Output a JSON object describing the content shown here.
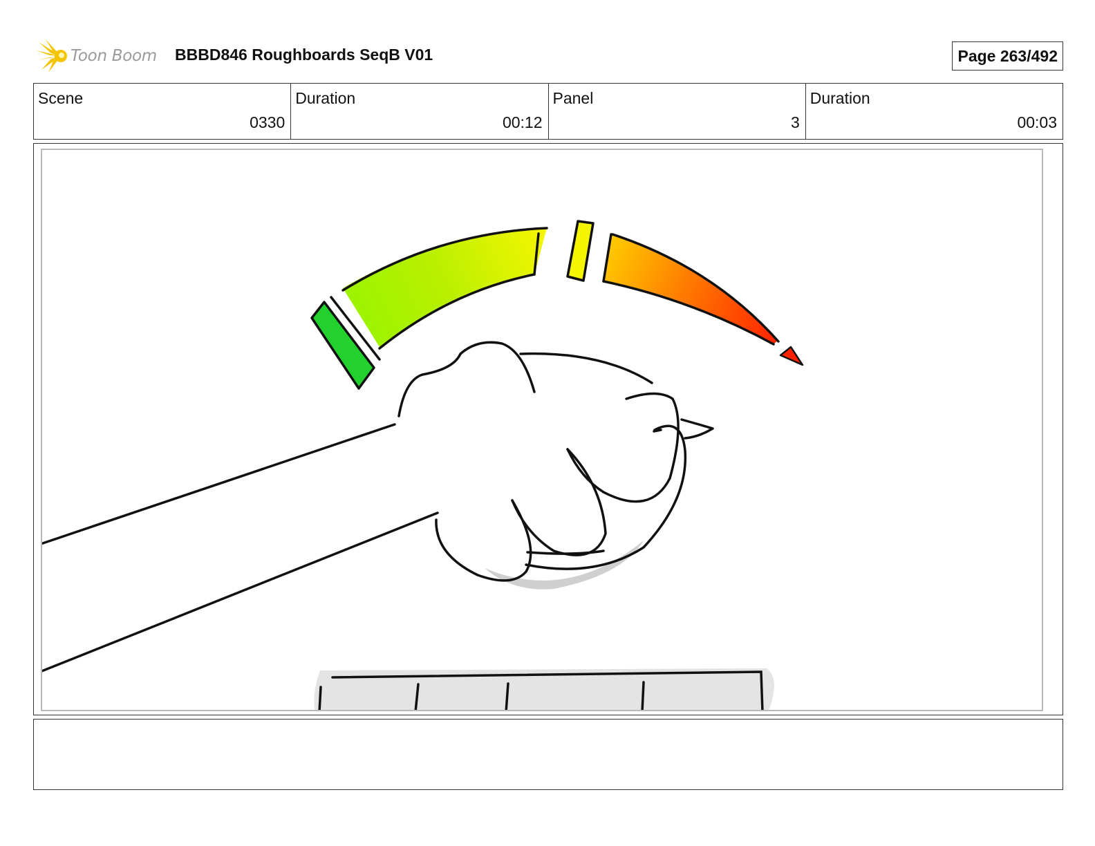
{
  "header": {
    "logo_text": "Toon Boom",
    "title": "BBBD846 Roughboards SeqB V01",
    "page_label": "Page 263/492"
  },
  "info": {
    "scene_label": "Scene",
    "scene_value": "0330",
    "scene_duration_label": "Duration",
    "scene_duration_value": "00:12",
    "panel_label": "Panel",
    "panel_value": "3",
    "panel_duration_label": "Duration",
    "panel_duration_value": "00:03"
  },
  "panel": {
    "meter_colors": [
      "#22d12e",
      "#8cf500",
      "#f5f500",
      "#ffc800",
      "#ff7a00",
      "#ff2200"
    ]
  },
  "notes": {
    "text": ""
  }
}
